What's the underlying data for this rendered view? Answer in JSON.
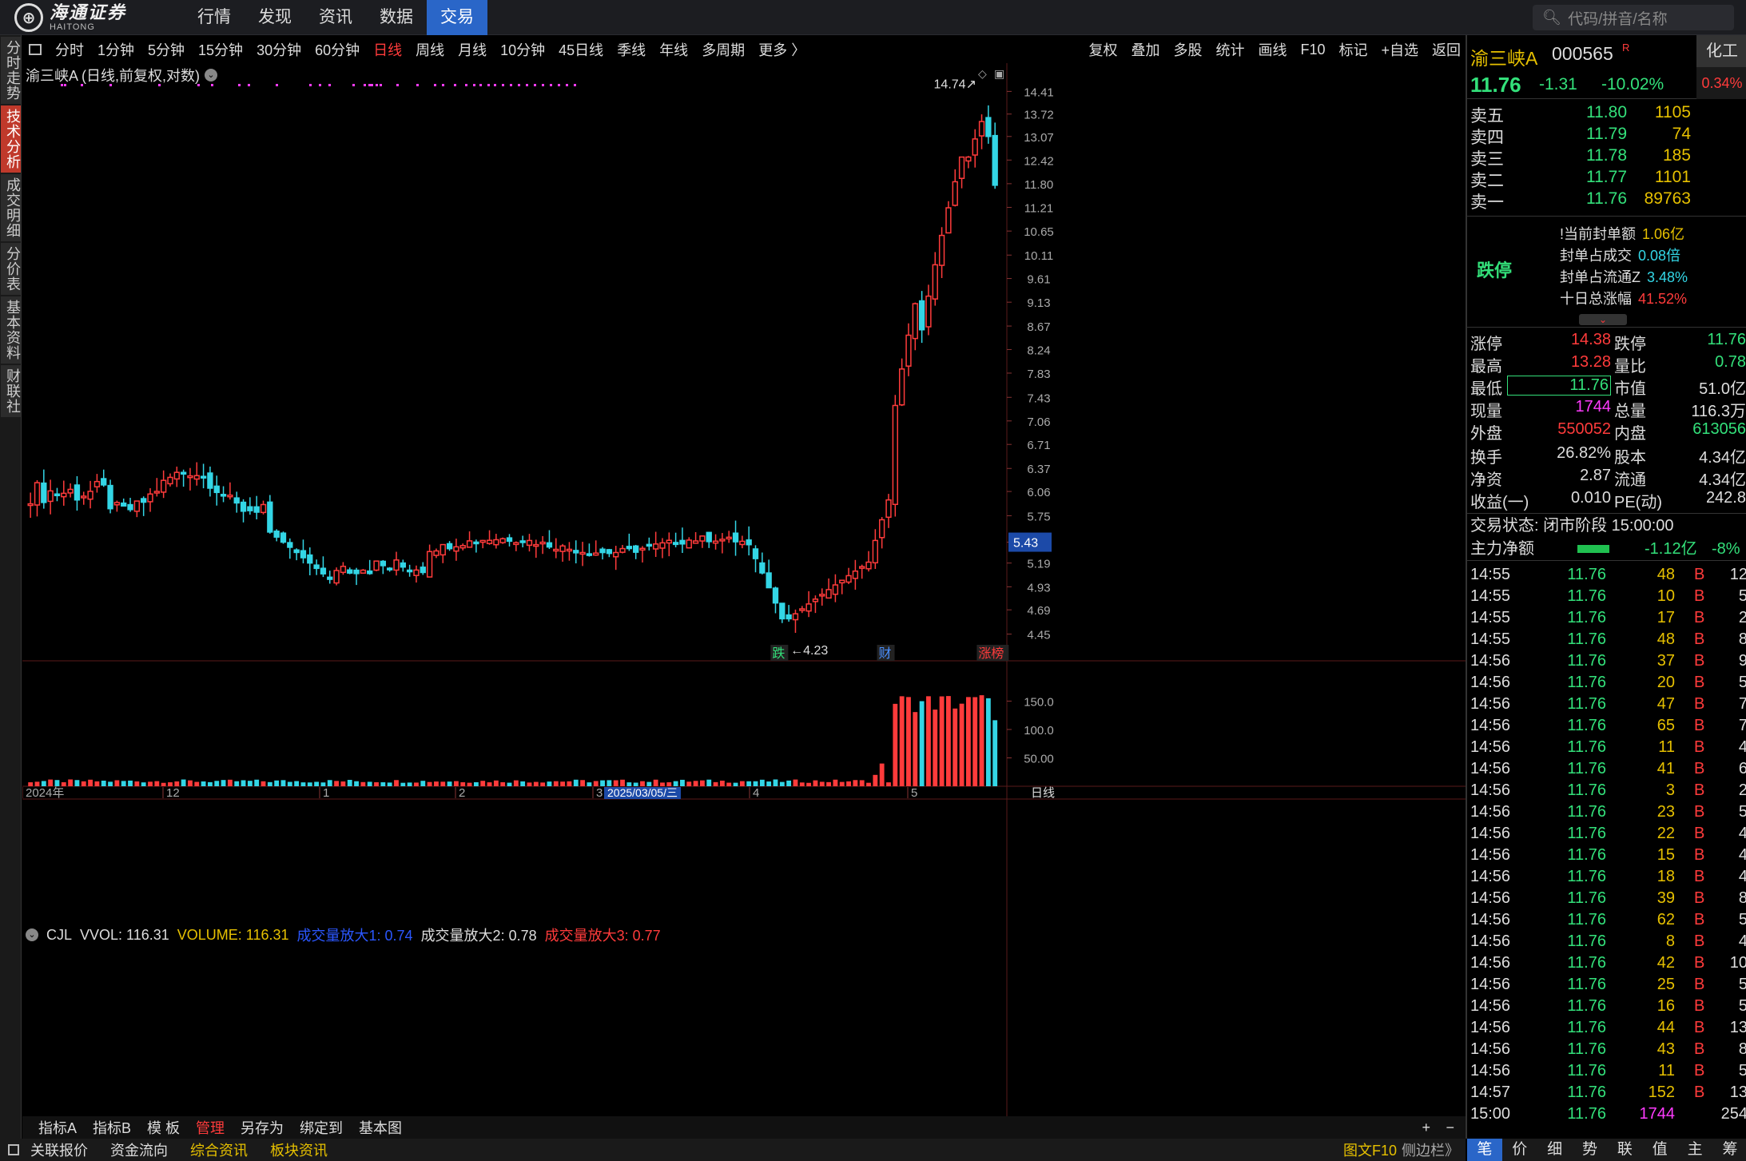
{
  "app": {
    "logo_cn": "海通证券",
    "logo_en": "HAITONG"
  },
  "nav": [
    {
      "label": "行情"
    },
    {
      "label": "发现"
    },
    {
      "label": "资讯"
    },
    {
      "label": "数据"
    },
    {
      "label": "交易"
    }
  ],
  "search": {
    "placeholder": "代码/拼音/名称"
  },
  "left_tabs": [
    {
      "label": "分时走势"
    },
    {
      "label": "技术分析"
    },
    {
      "label": "成交明细"
    },
    {
      "label": "分价表"
    },
    {
      "label": "基本资料"
    },
    {
      "label": "财联社"
    }
  ],
  "periods": [
    {
      "label": "分时"
    },
    {
      "label": "1分钟"
    },
    {
      "label": "5分钟"
    },
    {
      "label": "15分钟"
    },
    {
      "label": "30分钟"
    },
    {
      "label": "60分钟"
    },
    {
      "label": "日线"
    },
    {
      "label": "周线"
    },
    {
      "label": "月线"
    },
    {
      "label": "10分钟"
    },
    {
      "label": "45日线"
    },
    {
      "label": "季线"
    },
    {
      "label": "年线"
    },
    {
      "label": "多周期"
    },
    {
      "label": "更多 〉"
    }
  ],
  "tools": [
    {
      "label": "复权"
    },
    {
      "label": "叠加"
    },
    {
      "label": "多股"
    },
    {
      "label": "统计"
    },
    {
      "label": "画线"
    },
    {
      "label": "F10"
    },
    {
      "label": "标记"
    },
    {
      "label": "+自选"
    },
    {
      "label": "返回"
    }
  ],
  "chart_info": {
    "title": "渝三峡A (日线,前复权,对数)"
  },
  "vol_info": {
    "cjl": "CJL",
    "vvol": "VVOL: 116.31",
    "volume": "VOLUME: 116.31",
    "amp1": "成交量放大1: 0.74",
    "amp2": "成交量放大2: 0.78",
    "amp3": "成交量放大3: 0.77"
  },
  "chart_data": {
    "type": "candlestick",
    "y_scale": "log",
    "price_axis": [
      "14.41",
      "13.72",
      "13.07",
      "12.42",
      "11.80",
      "11.21",
      "10.65",
      "10.11",
      "9.61",
      "9.13",
      "8.67",
      "8.24",
      "7.83",
      "7.43",
      "7.06",
      "6.71",
      "6.37",
      "6.06",
      "5.75",
      "5.43",
      "5.19",
      "4.93",
      "4.69",
      "4.45"
    ],
    "price_range": [
      4.2,
      14.85
    ],
    "crosshair_price": "5.43",
    "high_label": "14.74",
    "low_label": "4.23",
    "vol_axis": [
      "150.0",
      "100.0",
      "50.00"
    ],
    "vol_range": [
      0,
      190
    ],
    "x_axis": [
      "2024年",
      "12",
      "1",
      "2",
      "3",
      "4",
      "5"
    ],
    "x_selected": "2025/03/05/三",
    "period_label": "日线",
    "markers": [
      {
        "label": "跌",
        "color": "#33e07a"
      },
      {
        "label": "财",
        "color": "#4a90ff"
      },
      {
        "label": "涨榜",
        "color": "#ff3b3b"
      }
    ],
    "colors": {
      "up": "#ff3b3b",
      "down": "#33d6e6",
      "flat": "#dddddd",
      "dots": "#ff3bff"
    }
  },
  "bottom_toolbar": [
    {
      "label": "指标A"
    },
    {
      "label": "指标B"
    },
    {
      "label": "模 板"
    },
    {
      "label": "管理"
    },
    {
      "label": "另存为"
    },
    {
      "label": "绑定到"
    },
    {
      "label": "基本图"
    }
  ],
  "bottom_toolbar2": [
    {
      "label": "关联报价"
    },
    {
      "label": "资金流向"
    },
    {
      "label": "综合资讯"
    },
    {
      "label": "板块资讯"
    }
  ],
  "bottom_right": {
    "f10": "图文F10",
    "sidebar": "侧边栏》"
  },
  "quote": {
    "name": "渝三峡A",
    "code": "000565",
    "r": "R",
    "industry": "化工",
    "industry_pct": "0.34%",
    "last": "11.76",
    "change": "-1.31",
    "change_pct": "-10.02%",
    "asks": [
      {
        "label": "卖五",
        "price": "11.80",
        "vol": "1105"
      },
      {
        "label": "卖四",
        "price": "11.79",
        "vol": "74"
      },
      {
        "label": "卖三",
        "price": "11.78",
        "vol": "185"
      },
      {
        "label": "卖二",
        "price": "11.77",
        "vol": "1101"
      },
      {
        "label": "卖一",
        "price": "11.76",
        "vol": "89763"
      }
    ],
    "seal": {
      "tag": "跌停",
      "items": [
        {
          "k": "!当前封单额",
          "v": "1.06亿"
        },
        {
          "k": "封单占成交",
          "v": "0.08倍"
        },
        {
          "k": "封单占流通Z",
          "v": "3.48%"
        },
        {
          "k": "十日总涨幅",
          "v": "41.52%"
        }
      ]
    },
    "stats": [
      [
        "涨停",
        "14.38",
        "跌停",
        "11.76"
      ],
      [
        "最高",
        "13.28",
        "量比",
        "0.78"
      ],
      [
        "最低",
        "11.76",
        "市值",
        "51.0亿"
      ],
      [
        "现量",
        "1744",
        "总量",
        "116.3万"
      ],
      [
        "外盘",
        "550052",
        "内盘",
        "613056"
      ],
      [
        "换手",
        "26.82%",
        "股本",
        "4.34亿"
      ],
      [
        "净资",
        "2.87",
        "流通",
        "4.34亿"
      ],
      [
        "收益(一)",
        "0.010",
        "PE(动)",
        "242.8"
      ]
    ],
    "trade_state": "交易状态: 闭市阶段 15:00:00",
    "net_flow": {
      "label": "主力净额",
      "value": "-1.12亿",
      "pct": "-8%"
    },
    "ticks": [
      {
        "t": "14:55",
        "p": "11.76",
        "v": "48",
        "b": "B",
        "n": "12"
      },
      {
        "t": "14:55",
        "p": "11.76",
        "v": "10",
        "b": "B",
        "n": "5"
      },
      {
        "t": "14:55",
        "p": "11.76",
        "v": "17",
        "b": "B",
        "n": "2"
      },
      {
        "t": "14:55",
        "p": "11.76",
        "v": "48",
        "b": "B",
        "n": "8"
      },
      {
        "t": "14:56",
        "p": "11.76",
        "v": "37",
        "b": "B",
        "n": "9"
      },
      {
        "t": "14:56",
        "p": "11.76",
        "v": "20",
        "b": "B",
        "n": "5"
      },
      {
        "t": "14:56",
        "p": "11.76",
        "v": "47",
        "b": "B",
        "n": "7"
      },
      {
        "t": "14:56",
        "p": "11.76",
        "v": "65",
        "b": "B",
        "n": "7"
      },
      {
        "t": "14:56",
        "p": "11.76",
        "v": "11",
        "b": "B",
        "n": "4"
      },
      {
        "t": "14:56",
        "p": "11.76",
        "v": "41",
        "b": "B",
        "n": "6"
      },
      {
        "t": "14:56",
        "p": "11.76",
        "v": "3",
        "b": "B",
        "n": "2"
      },
      {
        "t": "14:56",
        "p": "11.76",
        "v": "23",
        "b": "B",
        "n": "5"
      },
      {
        "t": "14:56",
        "p": "11.76",
        "v": "22",
        "b": "B",
        "n": "4"
      },
      {
        "t": "14:56",
        "p": "11.76",
        "v": "15",
        "b": "B",
        "n": "4"
      },
      {
        "t": "14:56",
        "p": "11.76",
        "v": "18",
        "b": "B",
        "n": "4"
      },
      {
        "t": "14:56",
        "p": "11.76",
        "v": "39",
        "b": "B",
        "n": "8"
      },
      {
        "t": "14:56",
        "p": "11.76",
        "v": "62",
        "b": "B",
        "n": "5"
      },
      {
        "t": "14:56",
        "p": "11.76",
        "v": "8",
        "b": "B",
        "n": "4"
      },
      {
        "t": "14:56",
        "p": "11.76",
        "v": "42",
        "b": "B",
        "n": "10"
      },
      {
        "t": "14:56",
        "p": "11.76",
        "v": "25",
        "b": "B",
        "n": "5"
      },
      {
        "t": "14:56",
        "p": "11.76",
        "v": "16",
        "b": "B",
        "n": "5"
      },
      {
        "t": "14:56",
        "p": "11.76",
        "v": "44",
        "b": "B",
        "n": "13"
      },
      {
        "t": "14:56",
        "p": "11.76",
        "v": "43",
        "b": "B",
        "n": "8"
      },
      {
        "t": "14:56",
        "p": "11.76",
        "v": "11",
        "b": "B",
        "n": "5"
      },
      {
        "t": "14:57",
        "p": "11.76",
        "v": "152",
        "b": "B",
        "n": "13"
      },
      {
        "t": "15:00",
        "p": "11.76",
        "v": "1744",
        "b": "",
        "n": "254"
      }
    ]
  },
  "rp_tabs": [
    {
      "label": "笔"
    },
    {
      "label": "价"
    },
    {
      "label": "细"
    },
    {
      "label": "势"
    },
    {
      "label": "联"
    },
    {
      "label": "值"
    },
    {
      "label": "主"
    },
    {
      "label": "筹"
    }
  ]
}
